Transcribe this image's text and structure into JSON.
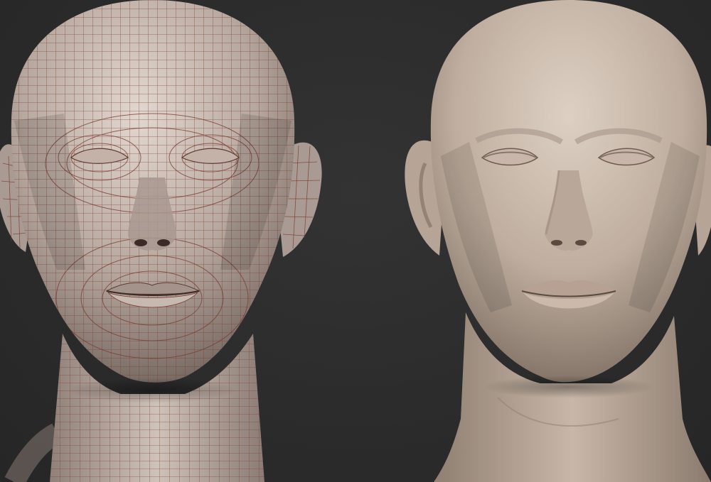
{
  "scene": {
    "background_color": "#2c2c2c",
    "models": [
      {
        "id": "wireframe-head",
        "display_mode": "polyframe",
        "wire_color": "#7a3a2e",
        "skin_color": "#b8a9a0"
      },
      {
        "id": "sculpted-head",
        "display_mode": "shaded",
        "skin_color": "#c3b2a4"
      }
    ]
  }
}
